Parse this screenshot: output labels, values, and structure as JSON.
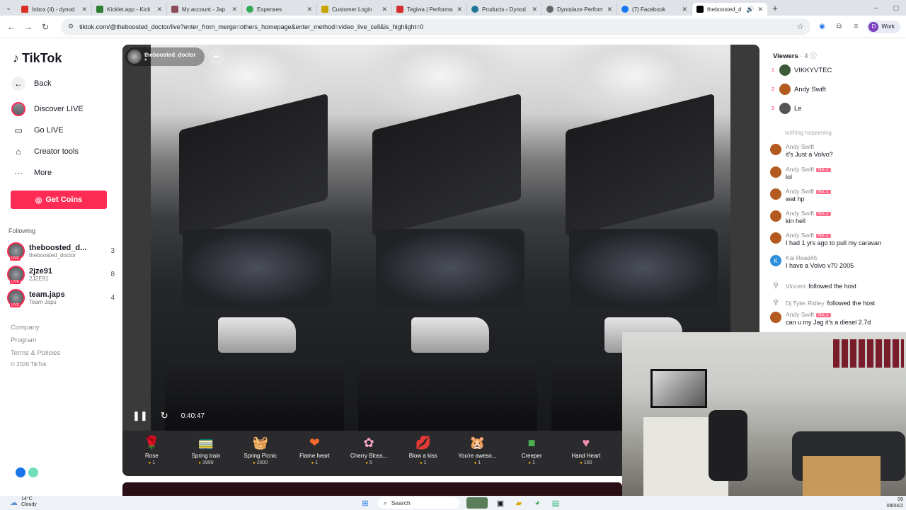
{
  "browser": {
    "tabs": [
      {
        "title": "Inbox (4) - dynod",
        "color": "#d93025"
      },
      {
        "title": "Kicklet.app - Kick",
        "color": "#2e7d32"
      },
      {
        "title": "My account - Jap",
        "color": "#8e4b5a"
      },
      {
        "title": "Expenses",
        "color": "#34a853"
      },
      {
        "title": "Customer Login",
        "color": "#c9a400"
      },
      {
        "title": "Tegiwa | Performa",
        "color": "#d32f2f"
      },
      {
        "title": "Products ‹ Dynod",
        "color": "#21759b"
      },
      {
        "title": "Dynodaze Perform",
        "color": "#666666"
      },
      {
        "title": "(7) Facebook",
        "color": "#1877f2"
      },
      {
        "title": "theboosted_d",
        "color": "#000000"
      }
    ],
    "url": "tiktok.com/@theboosted_doctor/live?enter_from_merge=others_homepage&enter_method=video_live_cell&is_highlight=0",
    "profile_label": "Work",
    "profile_initial": "D"
  },
  "sidebar": {
    "logo": "TikTok",
    "nav": [
      {
        "label": "Back"
      },
      {
        "label": "Discover LIVE"
      },
      {
        "label": "Go LIVE"
      },
      {
        "label": "Creator tools"
      },
      {
        "label": "More"
      }
    ],
    "coins_label": "Get Coins",
    "following_heading": "Following",
    "following": [
      {
        "name": "theboosted_d...",
        "handle": "theboosted_doctor",
        "count": "3",
        "live": "LIVE"
      },
      {
        "name": "2jze91",
        "handle": "2JZE91",
        "count": "8",
        "live": "LIVE"
      },
      {
        "name": "team.japs",
        "handle": "Team Japs",
        "count": "4",
        "live": "LIVE"
      }
    ],
    "footer": [
      "Company",
      "Program",
      "Terms & Policies"
    ],
    "copyright": "© 2026 TikTok"
  },
  "video": {
    "host_name": "theboosted_doctor",
    "elapsed": "0:40:47",
    "gifts": [
      {
        "name": "Rose",
        "price": "1",
        "icon": "🌹"
      },
      {
        "name": "Spring train",
        "price": "3999",
        "icon": "🚃"
      },
      {
        "name": "Spring Picnic",
        "price": "2000",
        "icon": "🧺"
      },
      {
        "name": "Flame heart",
        "price": "1",
        "icon": "❤"
      },
      {
        "name": "Cherry Bloss...",
        "price": "5",
        "icon": "🌸"
      },
      {
        "name": "Blow a kiss",
        "price": "1",
        "icon": "💋"
      },
      {
        "name": "You're aweso...",
        "price": "1",
        "icon": "🐹"
      },
      {
        "name": "Creeper",
        "price": "1",
        "icon": "■"
      },
      {
        "name": "Hand Heart",
        "price": "100",
        "icon": "🫶"
      }
    ]
  },
  "chat": {
    "viewers_label": "Viewers",
    "viewers_count": "· 4",
    "viewers": [
      {
        "rank": "1",
        "name": "VIKKYVTEC",
        "color": "#3d5a3a"
      },
      {
        "rank": "2",
        "name": "Andy Swift",
        "color": "#b35a1f"
      },
      {
        "rank": "3",
        "name": "Le",
        "color": "#555555"
      }
    ],
    "faded_text": "nothing happening",
    "messages": [
      {
        "user": "Andy Swift",
        "badge": "",
        "text": "it's Just a Volvo?"
      },
      {
        "user": "Andy Swift",
        "badge": "No. 2",
        "text": "lol"
      },
      {
        "user": "Andy Swift",
        "badge": "No. 1",
        "text": "wat hp"
      },
      {
        "user": "Andy Swift",
        "badge": "No. 1",
        "text": "kin hell"
      },
      {
        "user": "Andy Swift",
        "badge": "No. 1",
        "text": "I had 1 yrs ago to pull my caravan"
      },
      {
        "user": "Kai Read45",
        "badge": "",
        "text": "I have a Volvo v70 2005",
        "initial": "K"
      }
    ],
    "follows": [
      {
        "user": "Vincent",
        "text": "followed the host"
      },
      {
        "user": "Dj Tyler Ridley",
        "text": "followed the host"
      }
    ],
    "last_message": {
      "user": "Andy Swift",
      "badge": "No. 1",
      "text": "can u my Jag it's a diesel 2.7d"
    }
  },
  "taskbar": {
    "temp": "14°C",
    "weather": "Cloudy",
    "search_label": "Search",
    "time": "09",
    "date": "09/04/2"
  }
}
